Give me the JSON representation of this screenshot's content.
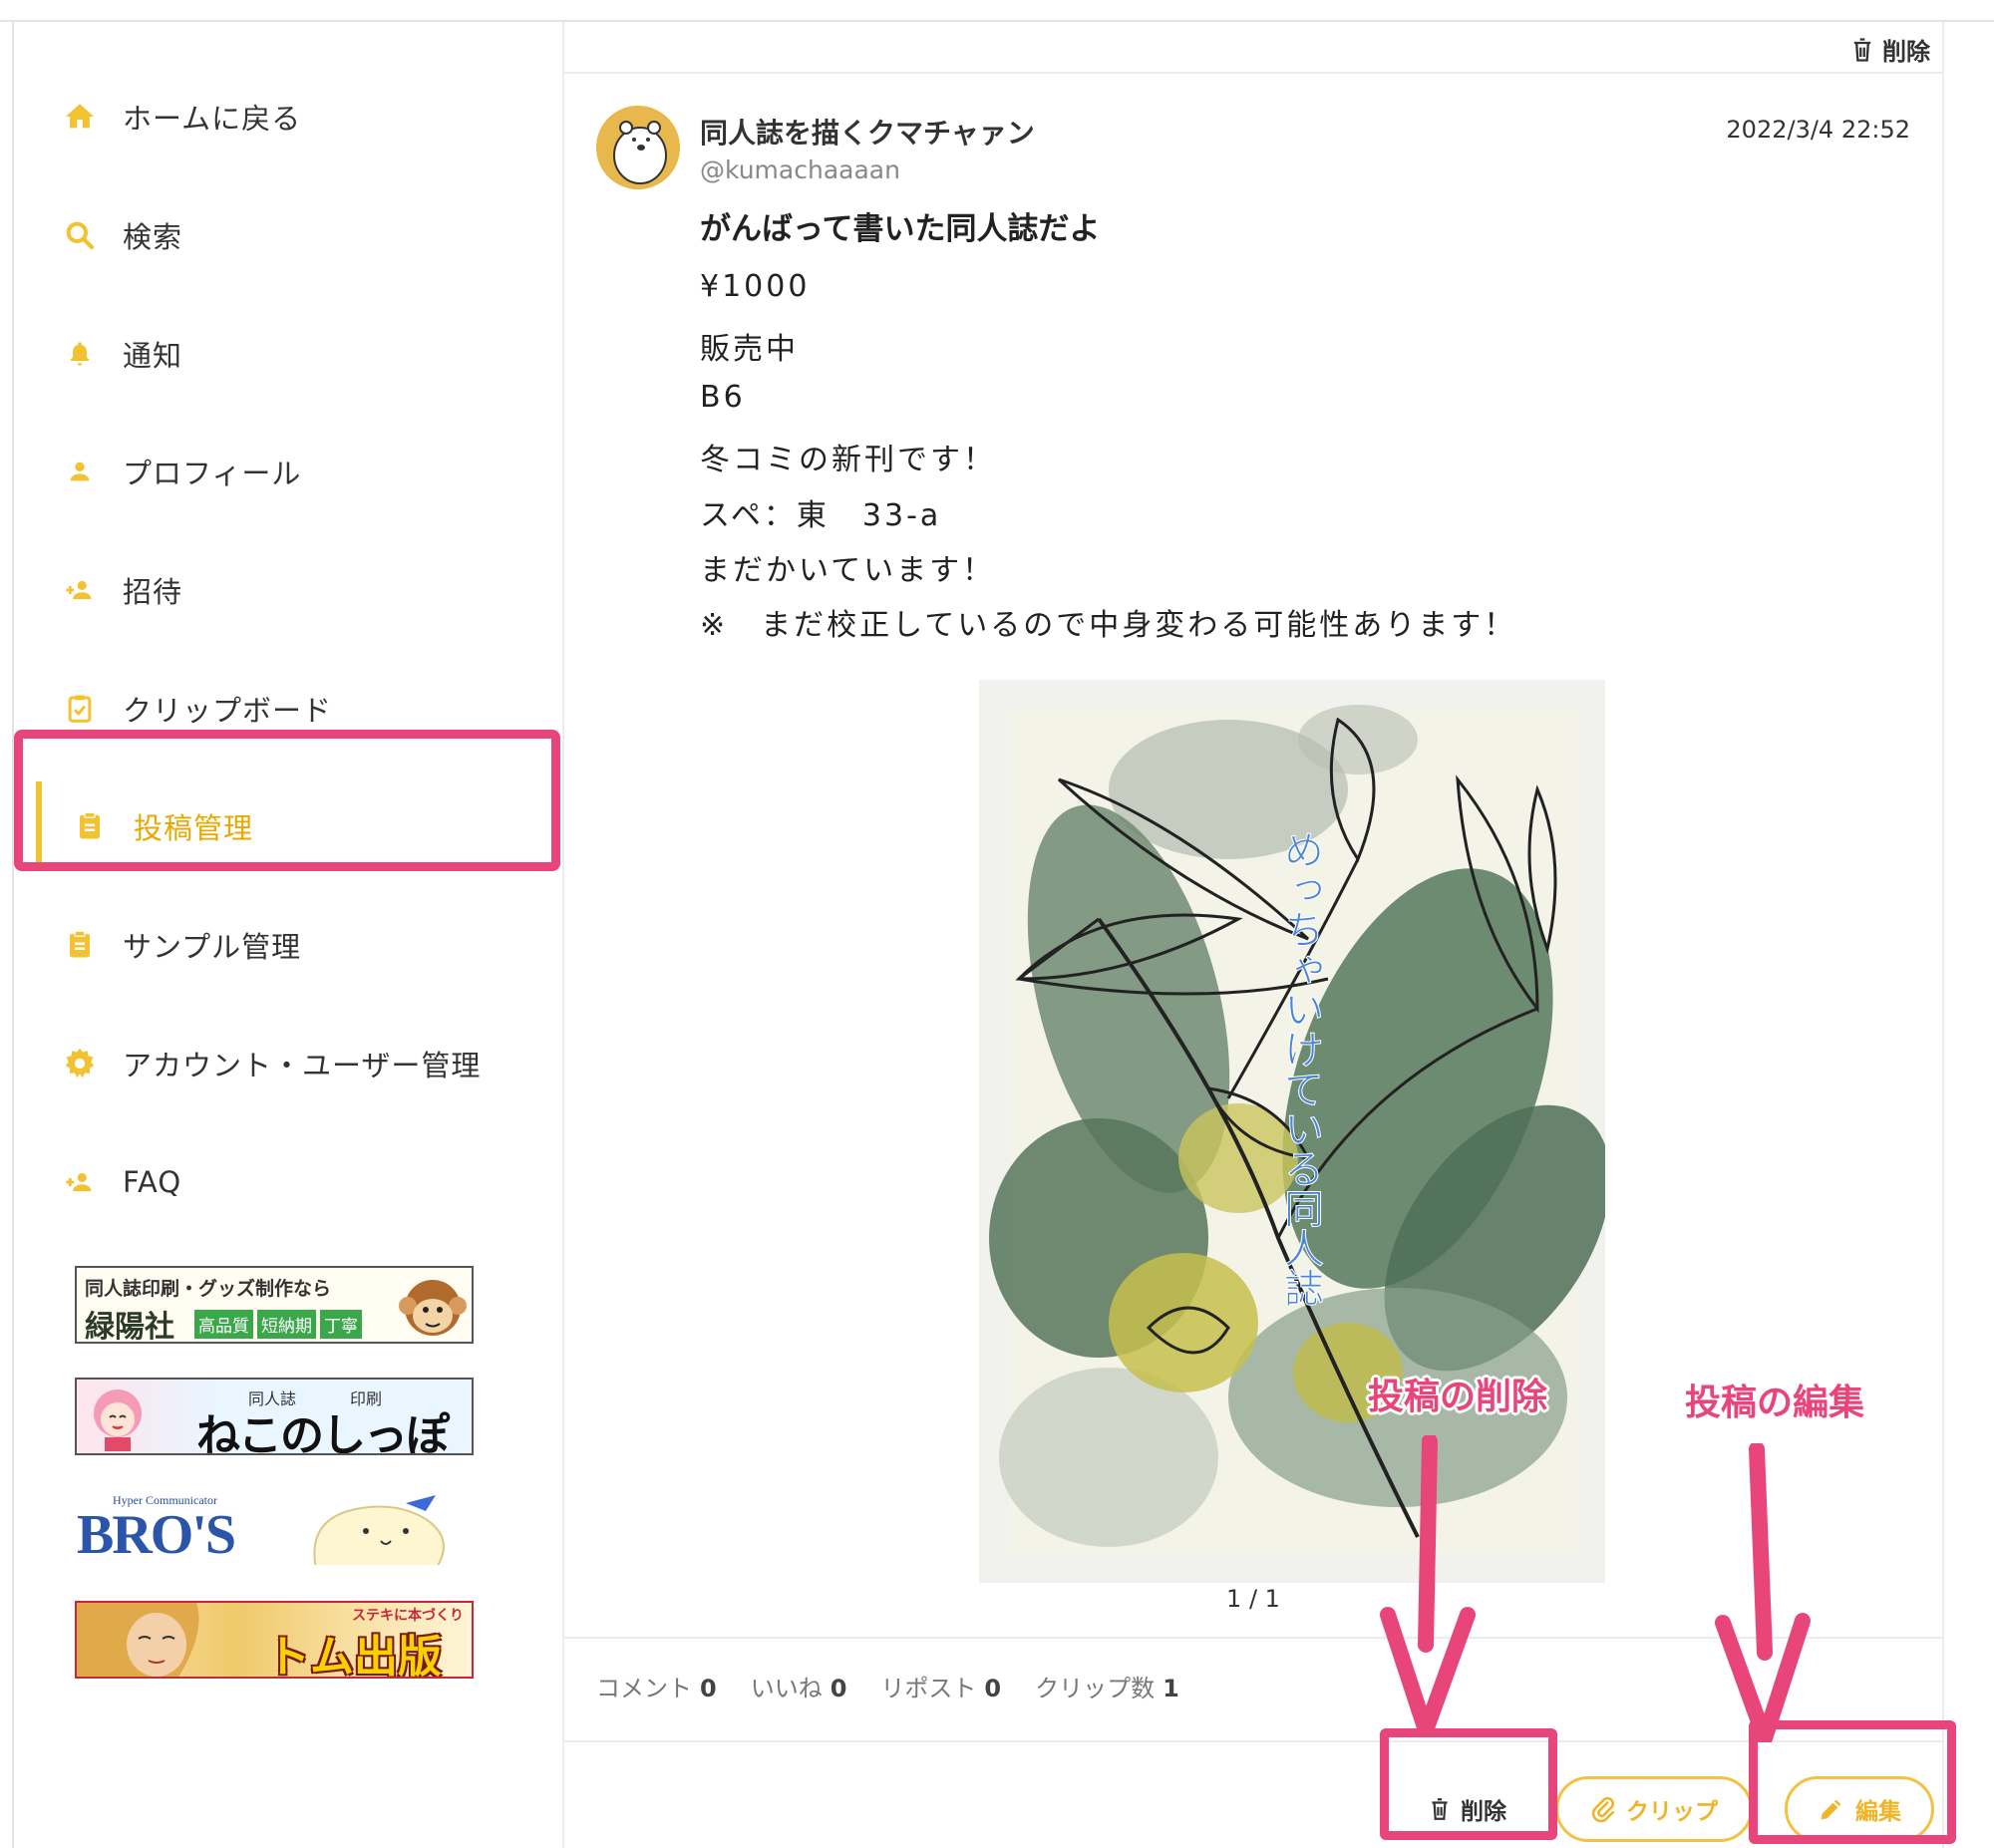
{
  "sidebar": {
    "items": [
      {
        "label": "ホームに戻る",
        "icon": "home-icon"
      },
      {
        "label": "検索",
        "icon": "search-icon"
      },
      {
        "label": "通知",
        "icon": "bell-icon"
      },
      {
        "label": "プロフィール",
        "icon": "person-icon"
      },
      {
        "label": "招待",
        "icon": "person-add-icon"
      },
      {
        "label": "クリップボード",
        "icon": "clipboard-check-icon"
      },
      {
        "label": "投稿管理",
        "icon": "document-icon",
        "active": true
      },
      {
        "label": "サンプル管理",
        "icon": "document-icon"
      },
      {
        "label": "アカウント・ユーザー管理",
        "icon": "gear-icon"
      },
      {
        "label": "FAQ",
        "icon": "person-add-icon"
      }
    ],
    "banners": [
      {
        "line1": "同人誌印刷・グッズ制作なら",
        "name": "緑陽社",
        "tags": [
          "高品質",
          "短納期",
          "丁寧"
        ]
      },
      {
        "small": "同人誌",
        "small2": "印刷",
        "name": "ねこのしっぽ"
      },
      {
        "small": "Hyper Communicator",
        "name": "BRO'S"
      },
      {
        "small": "ステキに本づくり",
        "name": "トム出版"
      }
    ]
  },
  "topbar": {
    "delete_label": "削除"
  },
  "post": {
    "author": "同人誌を描くクマチャァン",
    "handle": "@kumachaaaan",
    "timestamp": "2022/3/4 22:52",
    "title": "がんばって書いた同人誌だよ",
    "body_lines": [
      "¥1000",
      "販売中",
      "B6",
      "冬コミの新刊です！",
      "スペ：東　33-a",
      "まだかいています！",
      "※　まだ校正しているので中身変わる可能性あります！"
    ],
    "cover_text": "めっちゃいけている同人誌",
    "pager": "1 / 1"
  },
  "stats": {
    "comment_label": "コメント",
    "comment_count": "0",
    "like_label": "いいね",
    "like_count": "0",
    "repost_label": "リポスト",
    "repost_count": "0",
    "clip_label": "クリップ数",
    "clip_count": "1"
  },
  "actions": {
    "delete_label": "削除",
    "clip_label": "クリップ",
    "edit_label": "編集"
  },
  "annotations": {
    "delete_note": "投稿の削除",
    "edit_note": "投稿の編集"
  },
  "colors": {
    "accent": "#f2c231",
    "accent_text": "#e8a800",
    "highlight": "#e8467a"
  }
}
